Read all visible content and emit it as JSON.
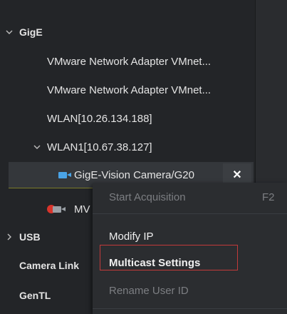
{
  "tree": {
    "gige": "GigE",
    "items": [
      "VMware Network Adapter VMnet...",
      "VMware Network Adapter VMnet...",
      "WLAN[10.26.134.188]",
      "WLAN1[10.67.38.127]"
    ],
    "selected_device": "GigE-Vision Camera/G20",
    "second_device": "MV",
    "usb": "USB",
    "camera_link": "Camera Link",
    "gentl": "GenTL"
  },
  "context_menu": {
    "start_acquisition": "Start Acquisition",
    "start_acquisition_key": "F2",
    "modify_ip": "Modify IP",
    "multicast_settings": "Multicast Settings",
    "rename_user_id": "Rename User ID"
  },
  "colors": {
    "camera_icon": "#4aa3e6",
    "highlight_box": "#c23a3a",
    "second_device_icon": "#d9342b"
  },
  "icons": {
    "close": "close-icon",
    "camera": "camera-icon"
  }
}
